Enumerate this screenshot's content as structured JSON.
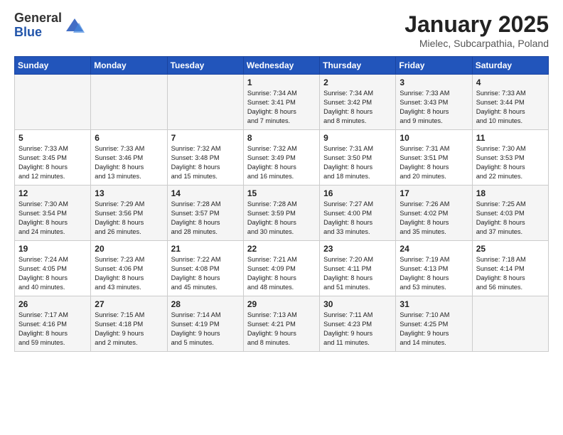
{
  "logo": {
    "general": "General",
    "blue": "Blue"
  },
  "title": "January 2025",
  "subtitle": "Mielec, Subcarpathia, Poland",
  "headers": [
    "Sunday",
    "Monday",
    "Tuesday",
    "Wednesday",
    "Thursday",
    "Friday",
    "Saturday"
  ],
  "weeks": [
    [
      {
        "day": "",
        "info": ""
      },
      {
        "day": "",
        "info": ""
      },
      {
        "day": "",
        "info": ""
      },
      {
        "day": "1",
        "info": "Sunrise: 7:34 AM\nSunset: 3:41 PM\nDaylight: 8 hours\nand 7 minutes."
      },
      {
        "day": "2",
        "info": "Sunrise: 7:34 AM\nSunset: 3:42 PM\nDaylight: 8 hours\nand 8 minutes."
      },
      {
        "day": "3",
        "info": "Sunrise: 7:33 AM\nSunset: 3:43 PM\nDaylight: 8 hours\nand 9 minutes."
      },
      {
        "day": "4",
        "info": "Sunrise: 7:33 AM\nSunset: 3:44 PM\nDaylight: 8 hours\nand 10 minutes."
      }
    ],
    [
      {
        "day": "5",
        "info": "Sunrise: 7:33 AM\nSunset: 3:45 PM\nDaylight: 8 hours\nand 12 minutes."
      },
      {
        "day": "6",
        "info": "Sunrise: 7:33 AM\nSunset: 3:46 PM\nDaylight: 8 hours\nand 13 minutes."
      },
      {
        "day": "7",
        "info": "Sunrise: 7:32 AM\nSunset: 3:48 PM\nDaylight: 8 hours\nand 15 minutes."
      },
      {
        "day": "8",
        "info": "Sunrise: 7:32 AM\nSunset: 3:49 PM\nDaylight: 8 hours\nand 16 minutes."
      },
      {
        "day": "9",
        "info": "Sunrise: 7:31 AM\nSunset: 3:50 PM\nDaylight: 8 hours\nand 18 minutes."
      },
      {
        "day": "10",
        "info": "Sunrise: 7:31 AM\nSunset: 3:51 PM\nDaylight: 8 hours\nand 20 minutes."
      },
      {
        "day": "11",
        "info": "Sunrise: 7:30 AM\nSunset: 3:53 PM\nDaylight: 8 hours\nand 22 minutes."
      }
    ],
    [
      {
        "day": "12",
        "info": "Sunrise: 7:30 AM\nSunset: 3:54 PM\nDaylight: 8 hours\nand 24 minutes."
      },
      {
        "day": "13",
        "info": "Sunrise: 7:29 AM\nSunset: 3:56 PM\nDaylight: 8 hours\nand 26 minutes."
      },
      {
        "day": "14",
        "info": "Sunrise: 7:28 AM\nSunset: 3:57 PM\nDaylight: 8 hours\nand 28 minutes."
      },
      {
        "day": "15",
        "info": "Sunrise: 7:28 AM\nSunset: 3:59 PM\nDaylight: 8 hours\nand 30 minutes."
      },
      {
        "day": "16",
        "info": "Sunrise: 7:27 AM\nSunset: 4:00 PM\nDaylight: 8 hours\nand 33 minutes."
      },
      {
        "day": "17",
        "info": "Sunrise: 7:26 AM\nSunset: 4:02 PM\nDaylight: 8 hours\nand 35 minutes."
      },
      {
        "day": "18",
        "info": "Sunrise: 7:25 AM\nSunset: 4:03 PM\nDaylight: 8 hours\nand 37 minutes."
      }
    ],
    [
      {
        "day": "19",
        "info": "Sunrise: 7:24 AM\nSunset: 4:05 PM\nDaylight: 8 hours\nand 40 minutes."
      },
      {
        "day": "20",
        "info": "Sunrise: 7:23 AM\nSunset: 4:06 PM\nDaylight: 8 hours\nand 43 minutes."
      },
      {
        "day": "21",
        "info": "Sunrise: 7:22 AM\nSunset: 4:08 PM\nDaylight: 8 hours\nand 45 minutes."
      },
      {
        "day": "22",
        "info": "Sunrise: 7:21 AM\nSunset: 4:09 PM\nDaylight: 8 hours\nand 48 minutes."
      },
      {
        "day": "23",
        "info": "Sunrise: 7:20 AM\nSunset: 4:11 PM\nDaylight: 8 hours\nand 51 minutes."
      },
      {
        "day": "24",
        "info": "Sunrise: 7:19 AM\nSunset: 4:13 PM\nDaylight: 8 hours\nand 53 minutes."
      },
      {
        "day": "25",
        "info": "Sunrise: 7:18 AM\nSunset: 4:14 PM\nDaylight: 8 hours\nand 56 minutes."
      }
    ],
    [
      {
        "day": "26",
        "info": "Sunrise: 7:17 AM\nSunset: 4:16 PM\nDaylight: 8 hours\nand 59 minutes."
      },
      {
        "day": "27",
        "info": "Sunrise: 7:15 AM\nSunset: 4:18 PM\nDaylight: 9 hours\nand 2 minutes."
      },
      {
        "day": "28",
        "info": "Sunrise: 7:14 AM\nSunset: 4:19 PM\nDaylight: 9 hours\nand 5 minutes."
      },
      {
        "day": "29",
        "info": "Sunrise: 7:13 AM\nSunset: 4:21 PM\nDaylight: 9 hours\nand 8 minutes."
      },
      {
        "day": "30",
        "info": "Sunrise: 7:11 AM\nSunset: 4:23 PM\nDaylight: 9 hours\nand 11 minutes."
      },
      {
        "day": "31",
        "info": "Sunrise: 7:10 AM\nSunset: 4:25 PM\nDaylight: 9 hours\nand 14 minutes."
      },
      {
        "day": "",
        "info": ""
      }
    ]
  ]
}
